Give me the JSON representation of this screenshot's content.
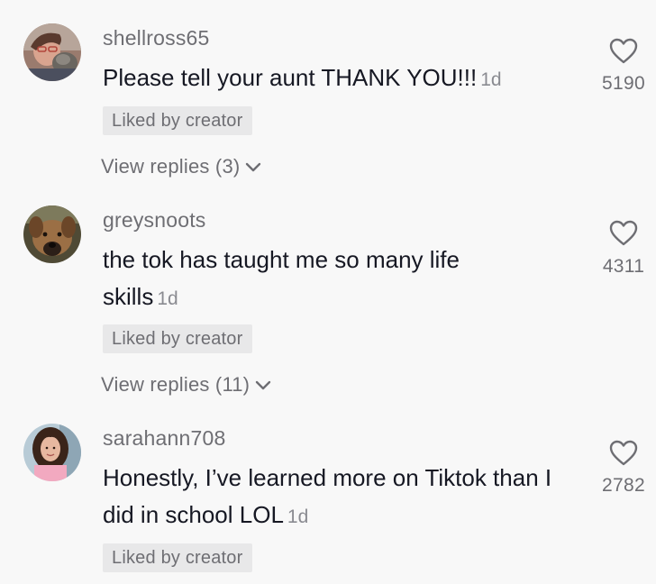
{
  "colors": {
    "background": "#f8f8f8",
    "username": "#6e6e73",
    "text": "#161823",
    "badge_bg": "#e8e8e9"
  },
  "comments": [
    {
      "username": "shellross65",
      "text": "Please tell your aunt THANK YOU!!!",
      "time": "1d",
      "badge": "Liked by creator",
      "replies_label": "View replies (3)",
      "likes": "5190",
      "like_icon": "heart-outline-icon"
    },
    {
      "username": "greysnoots",
      "text": "the tok has taught me so many life skills",
      "time": "1d",
      "badge": "Liked by creator",
      "replies_label": "View replies (11)",
      "likes": "4311",
      "like_icon": "heart-outline-icon"
    },
    {
      "username": "sarahann708",
      "text": "Honestly, I’ve learned more on Tiktok than I did in school LOL",
      "time": "1d",
      "badge": "Liked by creator",
      "likes": "2782",
      "like_icon": "heart-outline-icon"
    }
  ]
}
